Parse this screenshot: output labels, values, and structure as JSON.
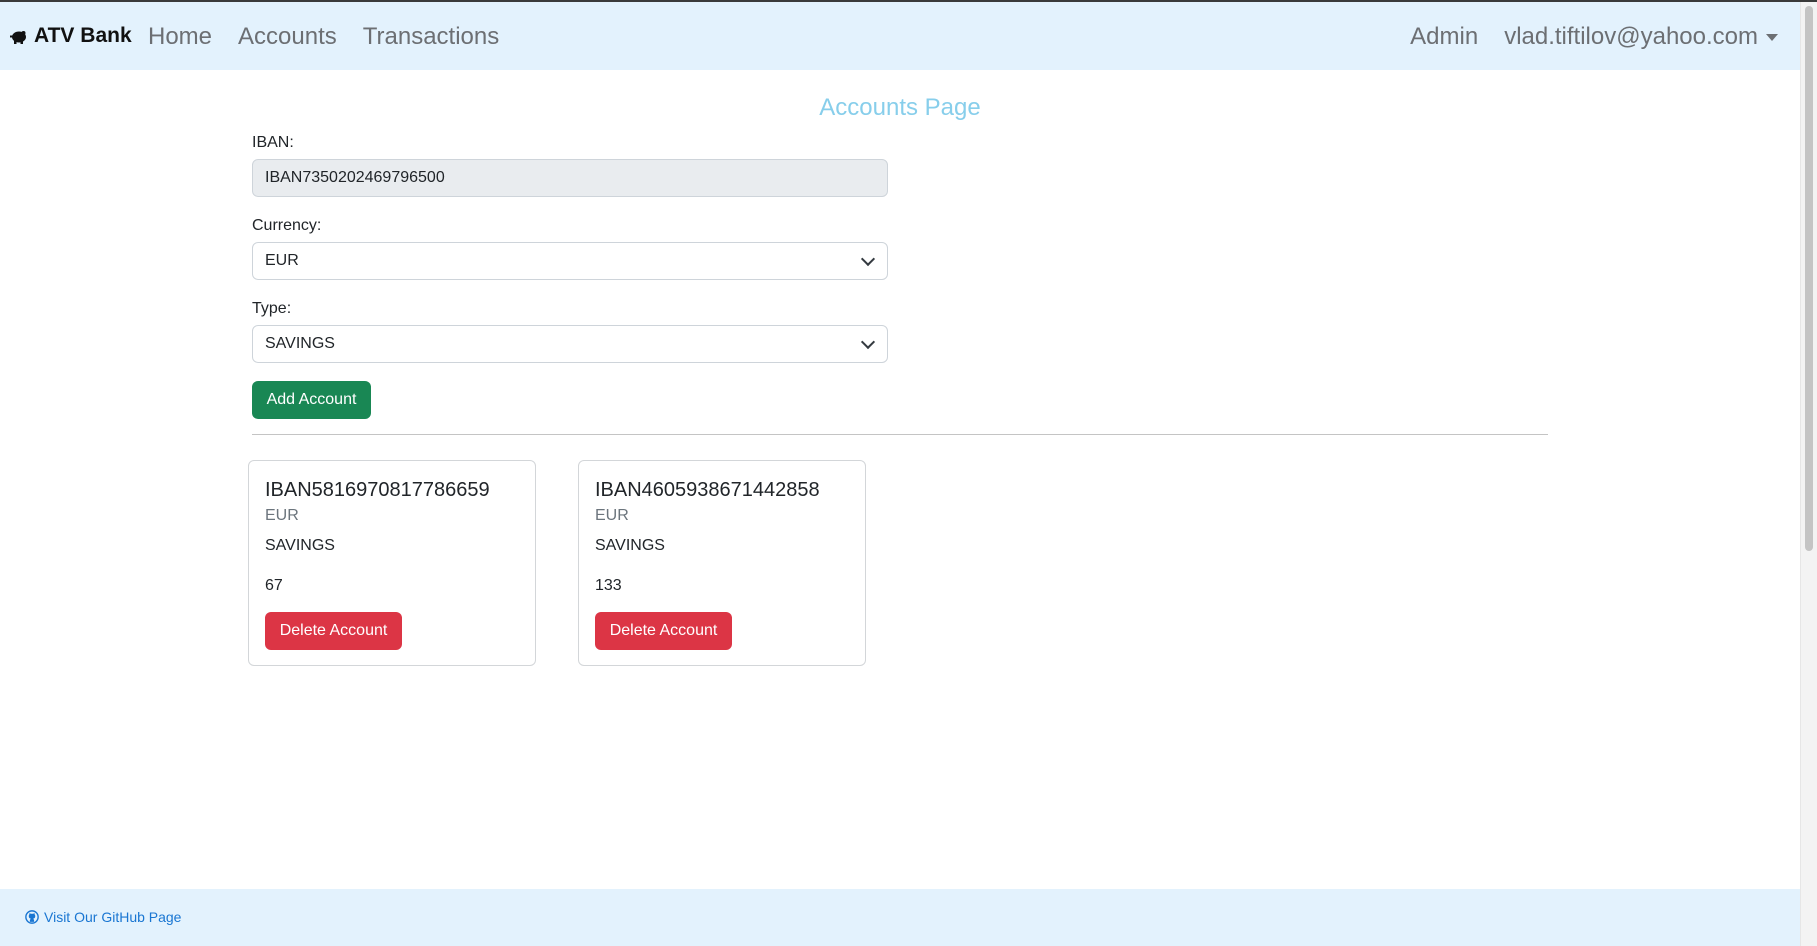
{
  "navbar": {
    "brand": "ATV Bank",
    "brand_icon": "piggy-bank-icon",
    "links": [
      "Home",
      "Accounts",
      "Transactions"
    ],
    "admin_label": "Admin",
    "user_email": "vlad.tiftilov@yahoo.com"
  },
  "page": {
    "title": "Accounts Page"
  },
  "form": {
    "iban_label": "IBAN:",
    "iban_value": "IBAN7350202469796500",
    "currency_label": "Currency:",
    "currency_value": "EUR",
    "type_label": "Type:",
    "type_value": "SAVINGS",
    "add_button": "Add Account"
  },
  "accounts": [
    {
      "iban": "IBAN5816970817786659",
      "currency": "EUR",
      "type": "SAVINGS",
      "balance": "67",
      "delete_label": "Delete Account"
    },
    {
      "iban": "IBAN4605938671442858",
      "currency": "EUR",
      "type": "SAVINGS",
      "balance": "133",
      "delete_label": "Delete Account"
    }
  ],
  "footer": {
    "github_link": "Visit Our GitHub Page",
    "github_icon": "github-icon"
  },
  "colors": {
    "navbar_bg": "#e3f2fd",
    "title_color": "#87ceeb",
    "success": "#198754",
    "danger": "#dc3545",
    "link": "#1976d2"
  }
}
